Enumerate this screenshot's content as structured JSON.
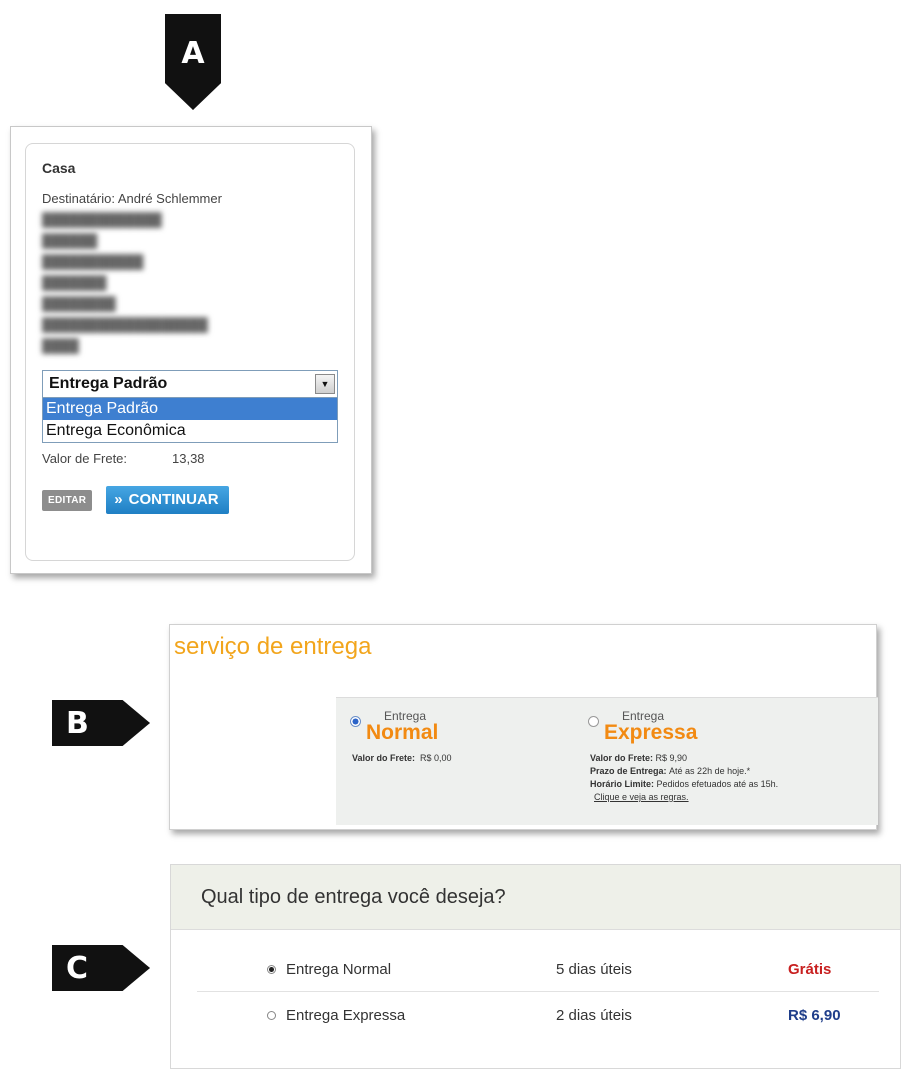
{
  "markers": {
    "a": "A",
    "b": "B",
    "c": "C"
  },
  "panel_a": {
    "title": "Casa",
    "recipient_line": "Destinatário: André Schlemmer",
    "select_value": "Entrega Padrão",
    "dropdown_options": [
      "Entrega Padrão",
      "Entrega Econômica"
    ],
    "freight_label": "Valor de Frete:",
    "freight_value": "13,38",
    "edit_label": "EDITAR",
    "continue_label": "CONTINUAR"
  },
  "panel_b": {
    "title": "serviço de entrega",
    "normal": {
      "small": "Entrega",
      "big": "Normal",
      "freight_label": "Valor do Frete:",
      "freight_value": "R$ 0,00",
      "selected": true
    },
    "expressa": {
      "small": "Entrega",
      "big": "Expressa",
      "freight_label": "Valor do Frete:",
      "freight_value": "R$ 9,90",
      "deadline_label": "Prazo de Entrega:",
      "deadline_value": "Até as 22h de hoje.*",
      "limit_label": "Horário Limite:",
      "limit_value": "Pedidos efetuados até as 15h.",
      "rules_link": "Clique e veja as regras.",
      "selected": false
    }
  },
  "panel_c": {
    "question": "Qual tipo de entrega você deseja?",
    "options": [
      {
        "name": "Entrega Normal",
        "days": "5 dias úteis",
        "price": "Grátis",
        "selected": true
      },
      {
        "name": "Entrega Expressa",
        "days": "2 dias úteis",
        "price": "R$ 6,90",
        "selected": false
      }
    ]
  },
  "colors": {
    "orange_title": "#f2a51c",
    "orange_option": "#f28a12",
    "continue_blue": "#1f7fc4",
    "free_red": "#c82020",
    "price_blue": "#1f3e8a"
  }
}
